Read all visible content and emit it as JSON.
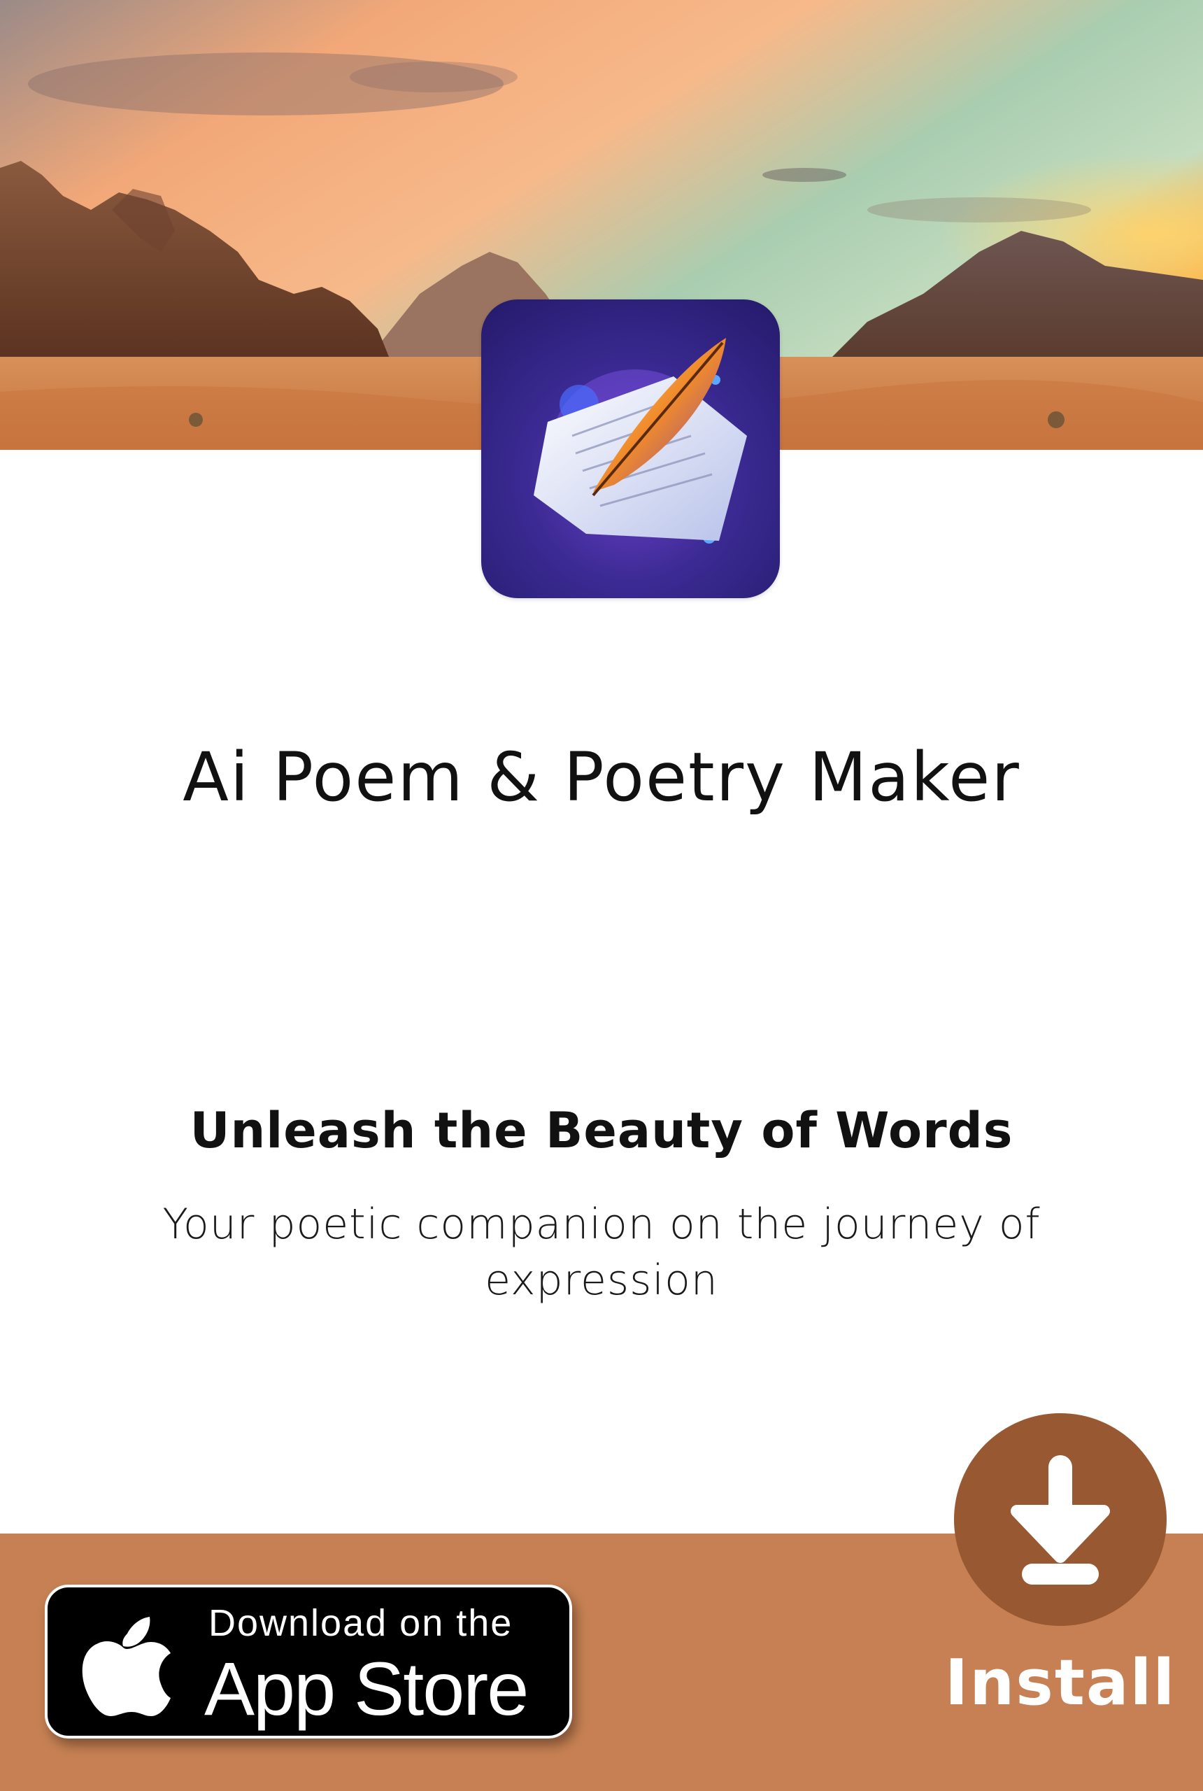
{
  "app": {
    "title": "Ai Poem & Poetry Maker",
    "icon": "quill-on-paper-icon"
  },
  "hero": {
    "image": "desert-landscape-sunset"
  },
  "promo": {
    "tagline": "Unleash the Beauty of Words",
    "subtitle": "Your poetic companion on the journey of expression"
  },
  "store_badge": {
    "small_text": "Download on the",
    "large_text": "App Store",
    "icon": "apple-logo-icon"
  },
  "install": {
    "label": "Install",
    "icon": "download-arrow-icon"
  },
  "colors": {
    "bottom_bar": "#c68053",
    "install_circle": "#985831",
    "badge_background": "#000000",
    "text_primary": "#111111"
  }
}
